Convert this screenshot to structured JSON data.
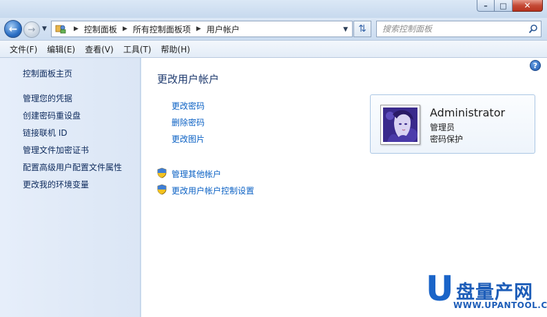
{
  "window": {
    "caption_min": "–",
    "caption_max": "□",
    "caption_close": "✕"
  },
  "address_bar": {
    "crumbs": [
      "控制面板",
      "所有控制面板项",
      "用户帐户"
    ]
  },
  "search": {
    "placeholder": "搜索控制面板"
  },
  "menu": {
    "items": [
      "文件(F)",
      "编辑(E)",
      "查看(V)",
      "工具(T)",
      "帮助(H)"
    ]
  },
  "sidebar": {
    "home": "控制面板主页",
    "items": [
      "管理您的凭据",
      "创建密码重设盘",
      "链接联机 ID",
      "管理文件加密证书",
      "配置高级用户配置文件属性",
      "更改我的环境变量"
    ]
  },
  "main": {
    "title": "更改用户帐户",
    "tasks": [
      "更改密码",
      "删除密码",
      "更改图片"
    ],
    "shield_tasks": [
      "管理其他帐户",
      "更改用户帐户控制设置"
    ],
    "help": "?"
  },
  "user": {
    "name": "Administrator",
    "role": "管理员",
    "status": "密码保护"
  },
  "watermark": {
    "letter": "U",
    "chinese": "盘量产网",
    "site": "WWW.UPANTOOL.COM"
  },
  "colors": {
    "link": "#0b61c4",
    "title": "#1e3a6e",
    "sidebar_link": "#0d2a5c"
  }
}
